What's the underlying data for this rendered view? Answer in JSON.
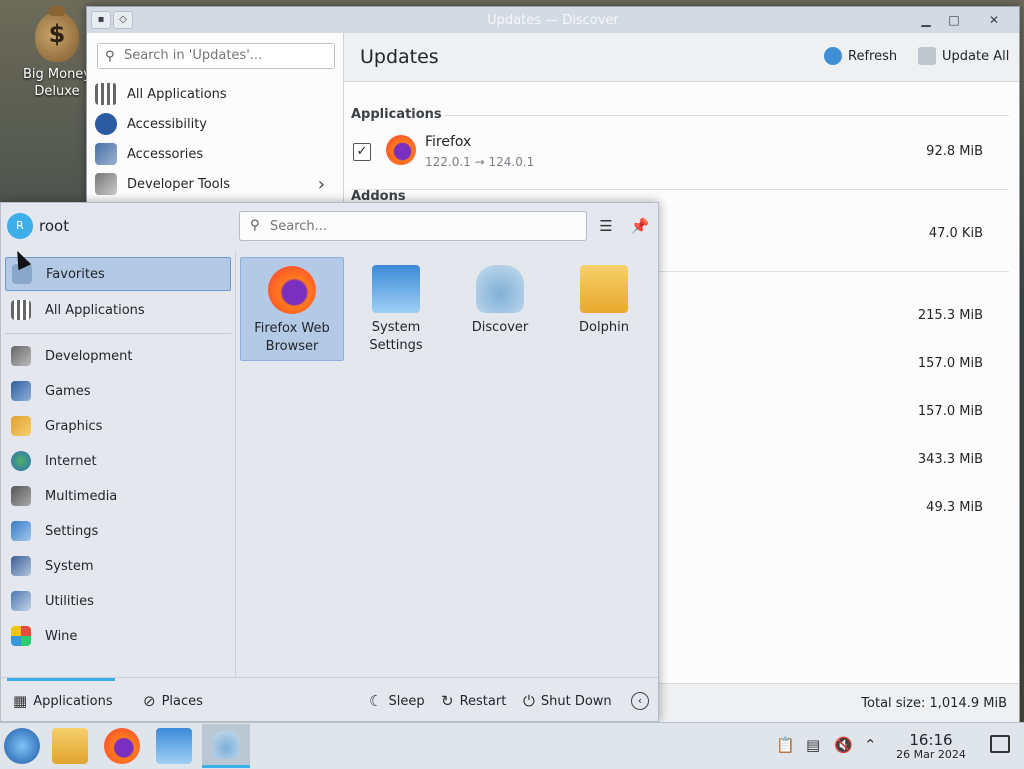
{
  "desktop": {
    "icon_label": "Big Money\nDeluxe",
    "icon_line1": "Big Money",
    "icon_line2": "Deluxe"
  },
  "discover": {
    "window_title": "Updates — Discover",
    "search_placeholder": "Search in 'Updates'...",
    "categories": [
      "All Applications",
      "Accessibility",
      "Accessories",
      "Developer Tools"
    ],
    "page_title": "Updates",
    "refresh_label": "Refresh",
    "update_all_label": "Update All",
    "sections": {
      "applications": "Applications",
      "addons": "Addons"
    },
    "items": [
      {
        "name": "Firefox",
        "version": "122.0.1 → 124.0.1",
        "size": "92.8 MiB",
        "checked": true
      },
      {
        "size": "47.0 KiB"
      },
      {
        "size": "215.3 MiB"
      },
      {
        "size": "157.0 MiB"
      },
      {
        "size": "157.0 MiB"
      },
      {
        "size": "343.3 MiB"
      },
      {
        "size": "49.3 MiB"
      }
    ],
    "total_size": "Total size: 1,014.9 MiB"
  },
  "kickoff": {
    "avatar_letter": "R",
    "user": "root",
    "search_placeholder": "Search...",
    "categories": [
      "Favorites",
      "All Applications",
      "Development",
      "Games",
      "Graphics",
      "Internet",
      "Multimedia",
      "Settings",
      "System",
      "Utilities",
      "Wine"
    ],
    "favorites": [
      {
        "line1": "Firefox Web",
        "line2": "Browser"
      },
      {
        "line1": "System",
        "line2": "Settings"
      },
      {
        "line1": "Discover",
        "line2": ""
      },
      {
        "line1": "Dolphin",
        "line2": ""
      }
    ],
    "bottom": {
      "applications": "Applications",
      "places": "Places",
      "sleep": "Sleep",
      "restart": "Restart",
      "shutdown": "Shut Down"
    }
  },
  "taskbar": {
    "time": "16:16",
    "date": "26 Mar 2024"
  },
  "colors": {
    "accent": "#3daee9",
    "selection": "#b4c9e6",
    "panel": "#e4e8ee"
  }
}
